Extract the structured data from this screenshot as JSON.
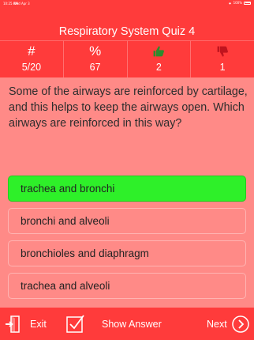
{
  "status_bar": {
    "time": "10:25 AM",
    "date": "Wed Apr 3",
    "battery": "100%"
  },
  "header": {
    "title": "Respiratory System Quiz 4"
  },
  "stats": [
    {
      "icon": "hash-icon",
      "glyph": "#",
      "value": "5/20"
    },
    {
      "icon": "percent-icon",
      "glyph": "%",
      "value": "67"
    },
    {
      "icon": "thumbs-up-icon",
      "value": "2"
    },
    {
      "icon": "thumbs-down-icon",
      "value": "1"
    }
  ],
  "question": {
    "text": "Some of the airways are reinforced by cartilage, and this helps to keep the airways open. Which airways are reinforced in this way?"
  },
  "answers": [
    {
      "label": "trachea and bronchi",
      "selected": true
    },
    {
      "label": "bronchi and alveoli",
      "selected": false
    },
    {
      "label": "bronchioles and diaphragm",
      "selected": false
    },
    {
      "label": "trachea and alveoli",
      "selected": false
    }
  ],
  "toolbar": {
    "exit_label": "Exit",
    "show_answer_label": "Show Answer",
    "next_label": "Next"
  },
  "colors": {
    "header": "#ff3b3b",
    "background": "#ff8a87",
    "selected_answer": "#2ef029",
    "thumbs_up": "#2e8b2e",
    "thumbs_down": "#c0141e"
  }
}
